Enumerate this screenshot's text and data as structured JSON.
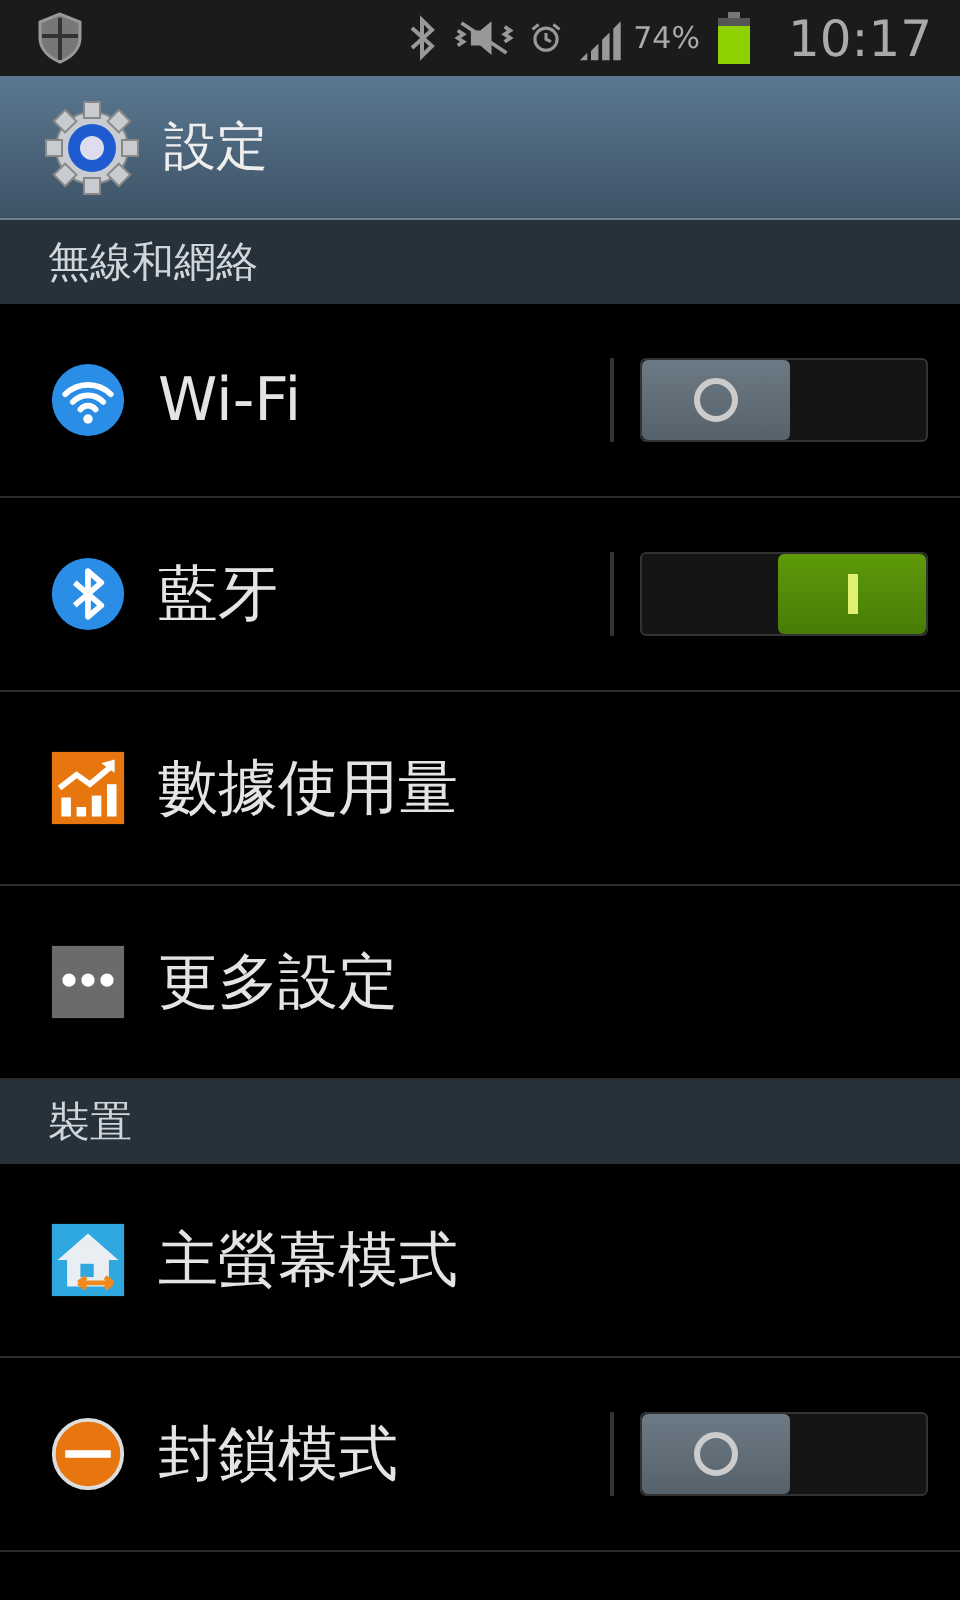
{
  "status_bar": {
    "battery_percent": "74%",
    "time": "10:17"
  },
  "action_bar": {
    "title": "設定"
  },
  "sections": [
    {
      "header": "無線和網絡",
      "items": [
        {
          "label": "Wi-Fi",
          "kind": "toggle",
          "on": false
        },
        {
          "label": "藍牙",
          "kind": "toggle",
          "on": true
        },
        {
          "label": "數據使用量",
          "kind": "link"
        },
        {
          "label": "更多設定",
          "kind": "link"
        }
      ]
    },
    {
      "header": "裝置",
      "items": [
        {
          "label": "主螢幕模式",
          "kind": "link"
        },
        {
          "label": "封鎖模式",
          "kind": "toggle",
          "on": false
        }
      ]
    }
  ]
}
